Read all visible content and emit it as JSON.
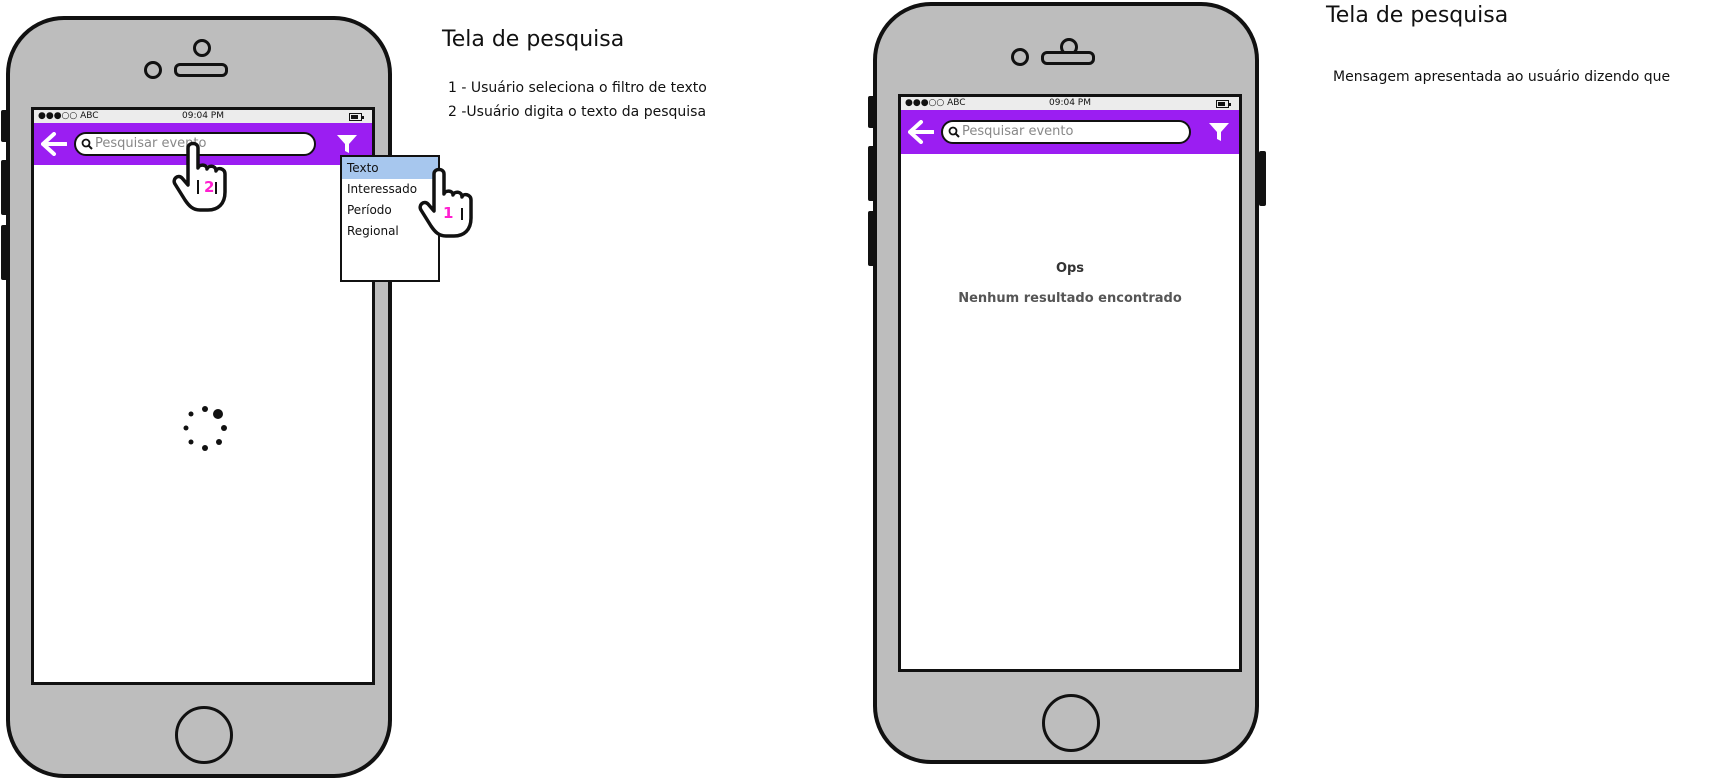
{
  "left_phone": {
    "status": {
      "carrier": "●●●○○ ABC",
      "time": "09:04 PM"
    },
    "search": {
      "placeholder": "Pesquisar evento"
    },
    "dropdown": {
      "items": [
        "Texto",
        "Interessado",
        "Período",
        "Regional"
      ],
      "selected": "Texto"
    },
    "markers": {
      "step_search": "2",
      "step_filter": "1"
    }
  },
  "left_notes": {
    "title": "Tela de pesquisa",
    "lines": [
      "1 -  Usuário seleciona o filtro de texto",
      "2 -Usuário digita o texto da pesquisa"
    ]
  },
  "right_phone": {
    "status": {
      "carrier": "●●●○○ ABC",
      "time": "09:04 PM"
    },
    "search": {
      "placeholder": "Pesquisar evento"
    },
    "message": {
      "title": "Ops",
      "subtitle": "Nenhum resultado encontrado"
    }
  },
  "right_notes": {
    "title": "Tela de pesquisa",
    "lines": [
      "Mensagem apresentada ao usuário dizendo que"
    ]
  },
  "colors": {
    "appbar": "#9b1ef2",
    "phone_body": "#bdbdbd",
    "dropdown_selected": "#a7c7ee",
    "step_marker": "#ff1fd0"
  },
  "icons": [
    "back-arrow-icon",
    "search-icon",
    "filter-icon",
    "loading-spinner-icon",
    "pointing-hand-icon"
  ]
}
